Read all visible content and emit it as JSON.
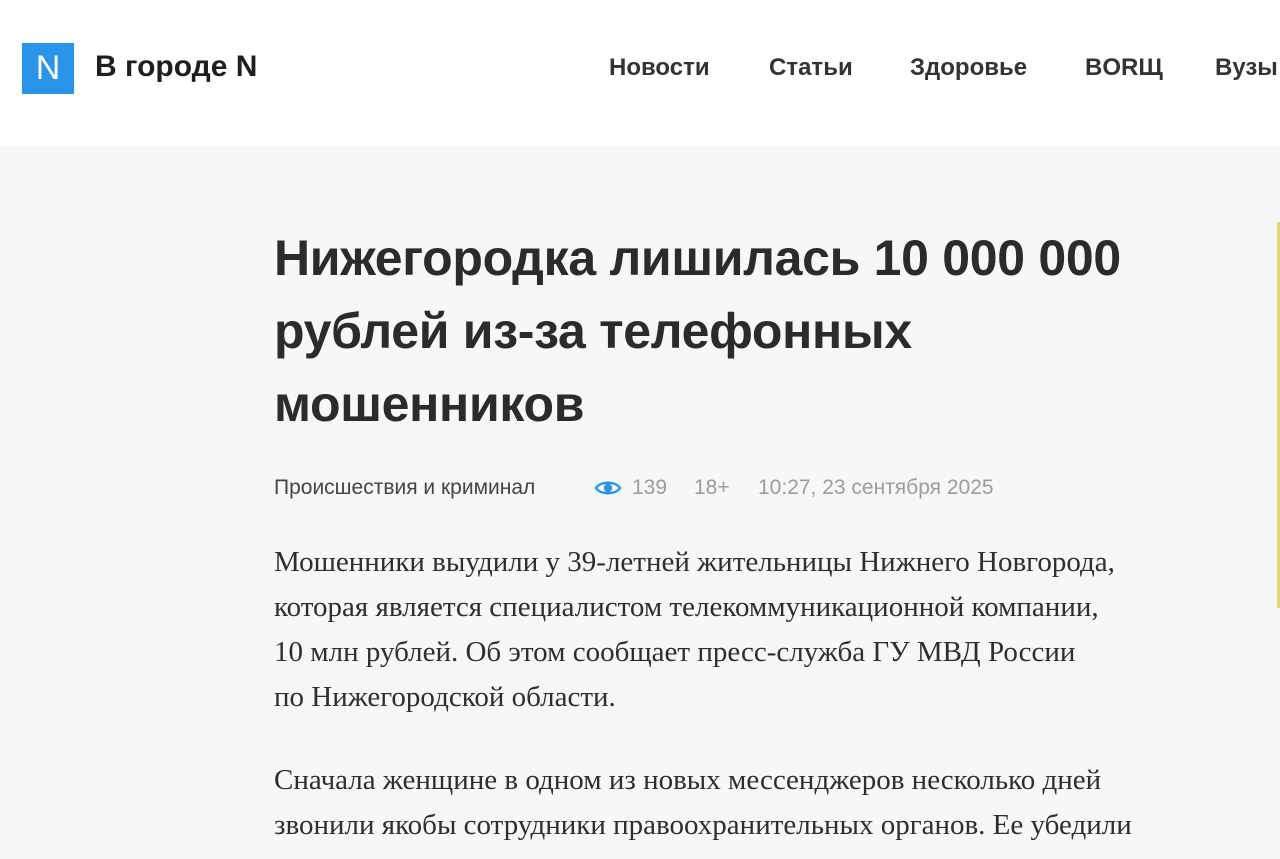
{
  "header": {
    "logo_letter": "N",
    "site_title": "В городе N",
    "nav": [
      "Новости",
      "Статьи",
      "Здоровье",
      "BORЩ",
      "Вузы"
    ]
  },
  "article": {
    "title": "Нижегородка лишилась 10 000 000 рублей из-за телефонных мошенников",
    "meta": {
      "category": "Происшествия и криминал",
      "eye_icon": "eye-icon",
      "views": "139",
      "age_rating": "18+",
      "datetime": "10:27, 23 сентября 2025"
    },
    "paragraphs": [
      [
        "Мошенники выудили у 39-летней жительницы Нижнего Новгорода,",
        "которая является специалистом телекоммуникационной компании,",
        "10 млн рублей. Об этом сообщает пресс-служба ГУ МВД России",
        "по Нижегородской области."
      ],
      [
        "Сначала женщине в одном из новых мессенджеров несколько дней",
        "звонили якобы сотрудники правоохранительных органов. Ее убедили"
      ]
    ]
  },
  "colors": {
    "logo": "#2a95e8",
    "eye_icon": "#2a95e8",
    "meta_muted": "#9c9c9c"
  }
}
